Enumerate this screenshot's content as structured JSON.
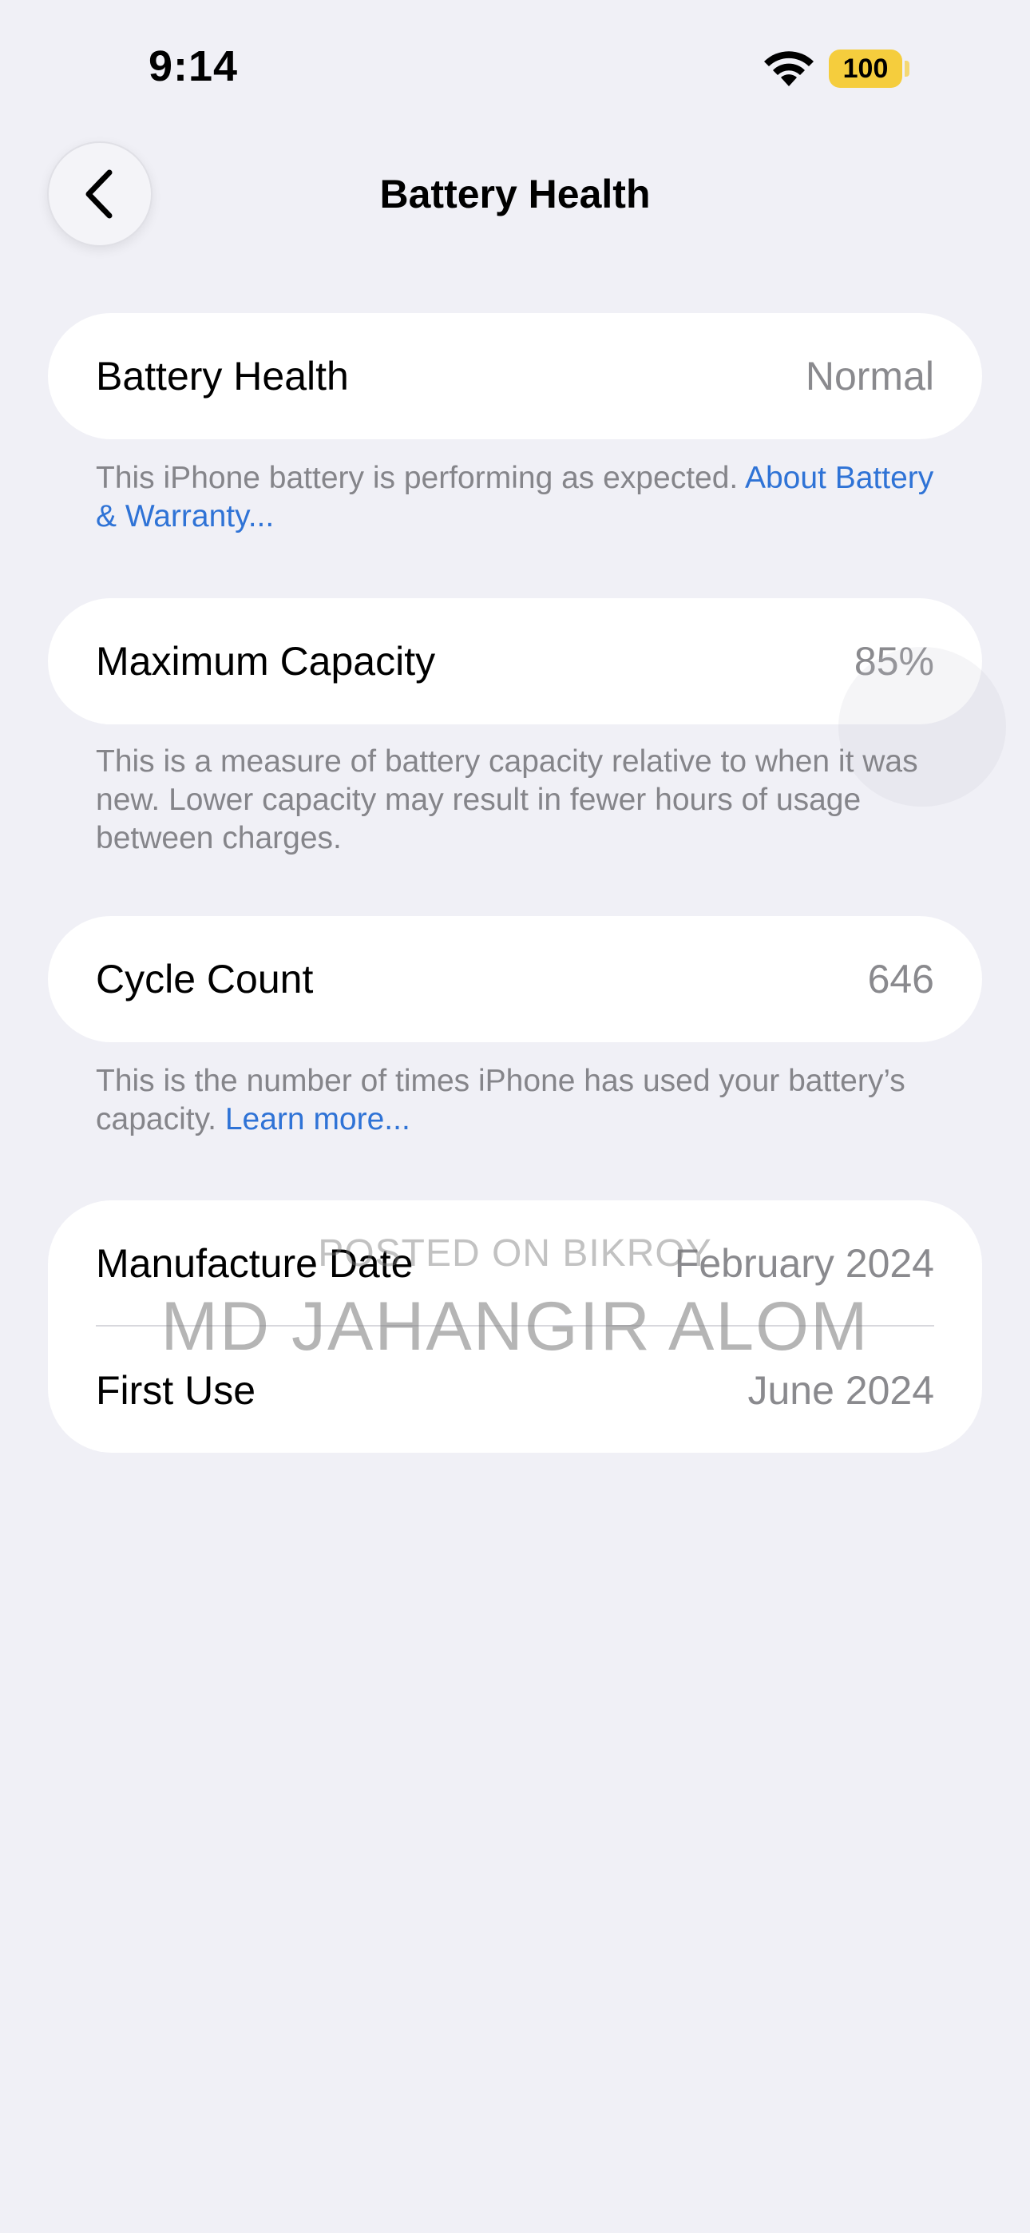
{
  "status_bar": {
    "time": "9:14",
    "battery_level": "100",
    "wifi_icon": "wifi-icon"
  },
  "nav": {
    "title": "Battery Health",
    "back_icon": "chevron-left-icon"
  },
  "sections": {
    "battery_health": {
      "label": "Battery Health",
      "value": "Normal",
      "footnote_text": "This iPhone battery is performing as expected. ",
      "footnote_link": "About Battery & Warranty..."
    },
    "maximum_capacity": {
      "label": "Maximum Capacity",
      "value": "85%",
      "footnote_text": "This is a measure of battery capacity relative to when it was new. Lower capacity may result in fewer hours of usage between charges."
    },
    "cycle_count": {
      "label": "Cycle Count",
      "value": "646",
      "footnote_text": "This is the number of times iPhone has used your battery’s capacity. ",
      "footnote_link": "Learn more..."
    },
    "dates": {
      "manufacture_label": "Manufacture Date",
      "manufacture_value": "February 2024",
      "first_use_label": "First Use",
      "first_use_value": "June 2024"
    }
  },
  "watermark": {
    "line1": "POSTED ON BIKROY",
    "line2": "MD JAHANGIR ALOM"
  },
  "colors": {
    "background": "#f0f0f6",
    "card": "#ffffff",
    "link": "#2f73d6",
    "secondary_text": "#8a8a8e",
    "battery": "#f5cd3d"
  }
}
